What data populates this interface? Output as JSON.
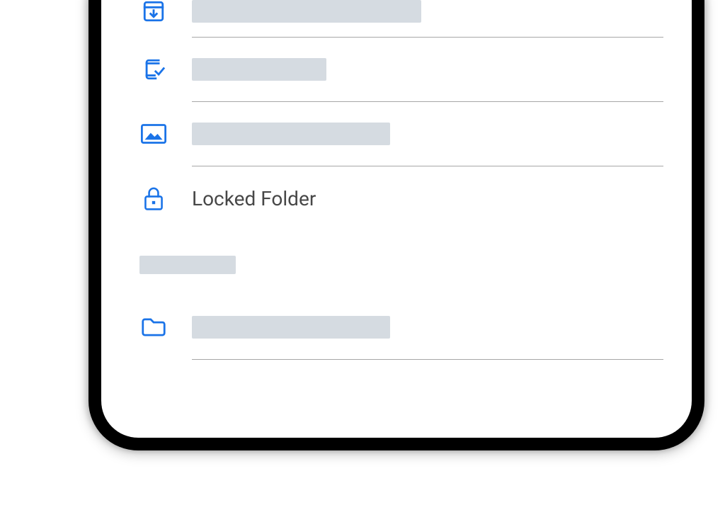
{
  "colors": {
    "accent": "#1a73e8",
    "placeholder": "#d5dbe1",
    "divider": "#a7a7a7",
    "text": "#474747"
  },
  "icons": {
    "archive": "archive-download-icon",
    "device_check": "device-check-icon",
    "image": "image-icon",
    "lock": "lock-icon",
    "folder": "folder-icon"
  },
  "rows": {
    "r1_placeholder_width": 324,
    "r2_placeholder_width": 190,
    "r3_placeholder_width": 280,
    "r4_label": "Locked Folder",
    "section_header_placeholder_width": 136,
    "r5_placeholder_width": 280
  }
}
